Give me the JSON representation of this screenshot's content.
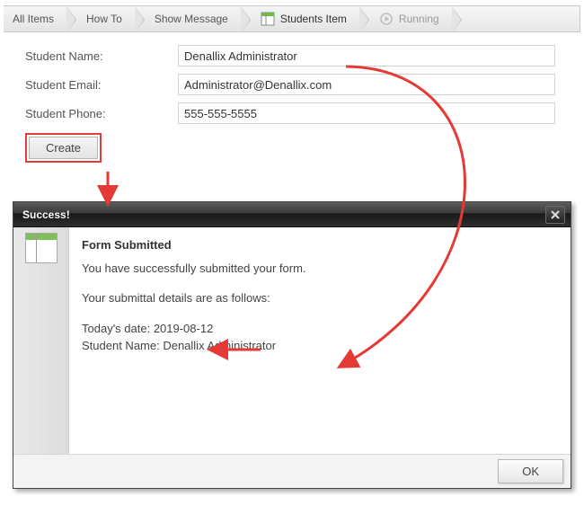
{
  "breadcrumb": {
    "all_items": "All Items",
    "how_to": "How To",
    "show_message": "Show Message",
    "students_item": "Students Item",
    "running": "Running"
  },
  "form": {
    "labels": {
      "name": "Student Name:",
      "email": "Student Email:",
      "phone": "Student Phone:"
    },
    "values": {
      "name": "Denallix Administrator",
      "email": "Administrator@Denallix.com",
      "phone": "555-555-5555"
    },
    "create_label": "Create"
  },
  "dialog": {
    "title": "Success!",
    "heading": "Form Submitted",
    "para1": "You have successfully submitted your form.",
    "para2": "Your submittal details are as follows:",
    "date_label": "Today's date: ",
    "date_value": "2019-08-12",
    "name_label": "Student Name: ",
    "name_value": "Denallix Administrator",
    "ok_label": "OK"
  }
}
